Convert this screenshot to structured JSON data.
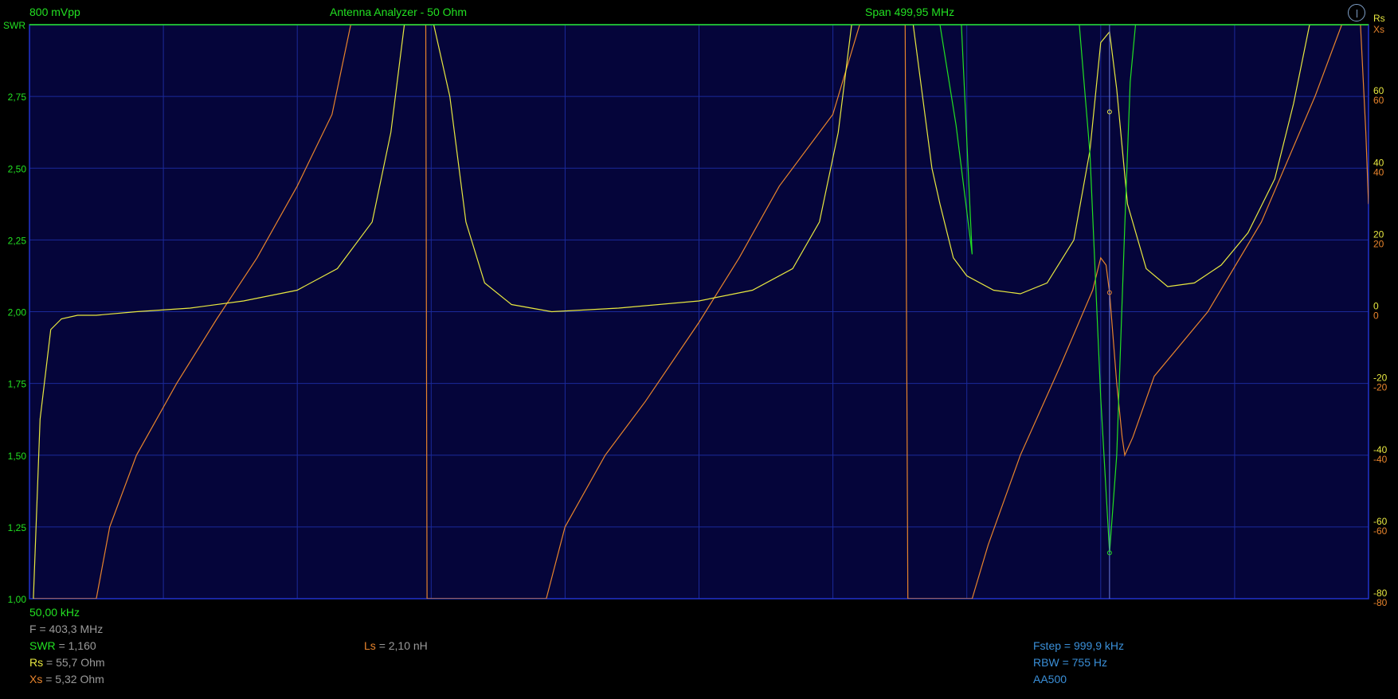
{
  "header": {
    "amplitude": "800 mVpp",
    "title": "Antenna Analyzer - 50 Ohm",
    "span": "Span 499,95 MHz"
  },
  "colors": {
    "swr": "#22e022",
    "rs": "#e8e840",
    "xs": "#e8842c",
    "grid": "#1b2a9a",
    "plot_bg": "#05053a",
    "info_blue": "#3a8fd8"
  },
  "readouts": {
    "start_freq": "50,00 kHz",
    "f_label": "F",
    "f_value": "= 403,3 MHz",
    "swr_label": "SWR",
    "swr_value": "= 1,160",
    "rs_label": "Rs",
    "rs_value": "= 55,7 Ohm",
    "xs_label": "Xs",
    "xs_value": "= 5,32 Ohm",
    "ls_label": "Ls",
    "ls_value": "= 2,10 nH",
    "fstep_label": "Fstep",
    "fstep_value": "= 999,9 kHz",
    "rbw_label": "RBW",
    "rbw_value": "= 755 Hz",
    "device": "AA500"
  },
  "chart_data": {
    "type": "line",
    "x_span_mhz": [
      0.05,
      500.0
    ],
    "marker_freq_mhz": 403.3,
    "left_axis": {
      "name": "SWR",
      "range": [
        1.0,
        3.0
      ],
      "ticks": [
        "1,00",
        "1,25",
        "1,50",
        "1,75",
        "2,00",
        "2,25",
        "2,50",
        "2,75"
      ]
    },
    "right_axis_rs": {
      "name": "Rs",
      "ticks": [
        "60",
        "40",
        "20",
        "0",
        "-20",
        "-40",
        "-60",
        "-80"
      ]
    },
    "right_axis_xs": {
      "name": "Xs",
      "ticks": [
        "60",
        "40",
        "20",
        "0",
        "-20",
        "-40",
        "-60",
        "-80"
      ]
    },
    "grid": true,
    "series": [
      {
        "name": "SWR",
        "axis": "left",
        "note_range": "values in SWR units",
        "points": [
          [
            0.05,
            3.0
          ],
          [
            335.0,
            3.0
          ],
          [
            340.0,
            3.0
          ],
          [
            346.0,
            2.65
          ],
          [
            352.0,
            2.2
          ],
          [
            348.0,
            3.0
          ],
          [
            355.0,
            3.0
          ],
          [
            338.0,
            3.0
          ],
          [
            346.0,
            3.0
          ],
          [
            368.0,
            3.0
          ],
          [
            372.0,
            3.0
          ],
          [
            383.0,
            3.0
          ],
          [
            385.0,
            3.0
          ],
          [
            392.0,
            3.0
          ],
          [
            396.0,
            2.55
          ],
          [
            400.0,
            1.7
          ],
          [
            403.3,
            1.16
          ],
          [
            406.0,
            1.5
          ],
          [
            409.0,
            2.3
          ],
          [
            411.0,
            2.8
          ],
          [
            413.0,
            3.0
          ],
          [
            500.0,
            3.0
          ]
        ]
      }
    ],
    "rs_points": [
      [
        1.5,
        -80
      ],
      [
        4,
        -30
      ],
      [
        8,
        -5
      ],
      [
        12,
        -2
      ],
      [
        18,
        -1
      ],
      [
        25,
        -1
      ],
      [
        40,
        0
      ],
      [
        60,
        1
      ],
      [
        80,
        3
      ],
      [
        100,
        6
      ],
      [
        115,
        12
      ],
      [
        128,
        25
      ],
      [
        135,
        50
      ],
      [
        140,
        85
      ],
      [
        145,
        85
      ],
      [
        151,
        85
      ],
      [
        157,
        60
      ],
      [
        163,
        25
      ],
      [
        170,
        8
      ],
      [
        180,
        2
      ],
      [
        195,
        0
      ],
      [
        220,
        1
      ],
      [
        250,
        3
      ],
      [
        270,
        6
      ],
      [
        285,
        12
      ],
      [
        295,
        25
      ],
      [
        302,
        50
      ],
      [
        307,
        85
      ],
      [
        326,
        85
      ],
      [
        330,
        85
      ],
      [
        337,
        40
      ],
      [
        340,
        30
      ],
      [
        345,
        15
      ],
      [
        350,
        10
      ],
      [
        360,
        6
      ],
      [
        370,
        5
      ],
      [
        380,
        8
      ],
      [
        390,
        20
      ],
      [
        396,
        45
      ],
      [
        400,
        75
      ],
      [
        403.3,
        78
      ],
      [
        406,
        62
      ],
      [
        410,
        30
      ],
      [
        417,
        12
      ],
      [
        425,
        7
      ],
      [
        435,
        8
      ],
      [
        445,
        13
      ],
      [
        455,
        22
      ],
      [
        465,
        37
      ],
      [
        472,
        58
      ],
      [
        478,
        85
      ],
      [
        500,
        85
      ]
    ],
    "xs_points": [
      [
        1.5,
        -80
      ],
      [
        25,
        -80
      ],
      [
        30,
        -60
      ],
      [
        40,
        -40
      ],
      [
        55,
        -20
      ],
      [
        70,
        -2
      ],
      [
        85,
        15
      ],
      [
        100,
        35
      ],
      [
        113,
        55
      ],
      [
        120,
        85
      ],
      [
        148,
        85
      ],
      [
        148.5,
        -80
      ],
      [
        193,
        -80
      ],
      [
        200,
        -60
      ],
      [
        215,
        -40
      ],
      [
        230,
        -25
      ],
      [
        250,
        -3
      ],
      [
        265,
        15
      ],
      [
        280,
        35
      ],
      [
        300,
        55
      ],
      [
        310,
        85
      ],
      [
        327,
        85
      ],
      [
        328,
        -80
      ],
      [
        352,
        -80
      ],
      [
        358,
        -65
      ],
      [
        370,
        -40
      ],
      [
        385,
        -15
      ],
      [
        397,
        6
      ],
      [
        400,
        15
      ],
      [
        402,
        13
      ],
      [
        403.3,
        5.32
      ],
      [
        406,
        -20
      ],
      [
        408,
        -35
      ],
      [
        409,
        -40
      ],
      [
        412,
        -35
      ],
      [
        420,
        -18
      ],
      [
        440,
        0
      ],
      [
        460,
        25
      ],
      [
        480,
        60
      ],
      [
        490,
        85
      ],
      [
        497,
        85
      ],
      [
        499,
        50
      ],
      [
        500,
        30
      ]
    ]
  }
}
